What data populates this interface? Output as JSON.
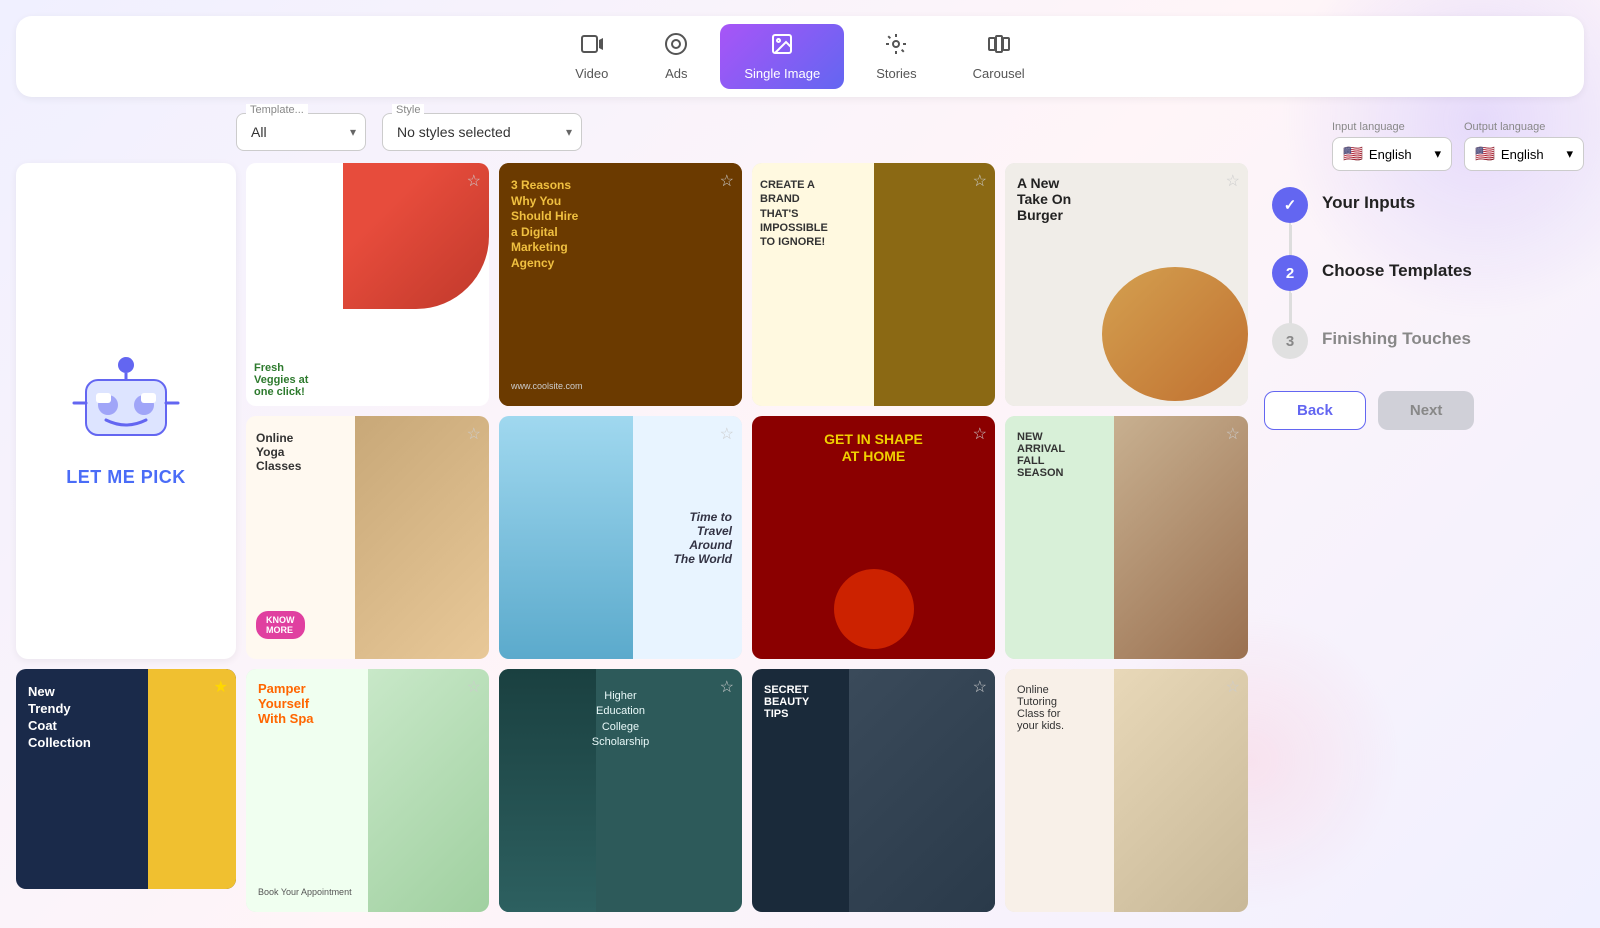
{
  "header": {
    "nav_items": [
      {
        "id": "video",
        "label": "Video",
        "icon": "▶",
        "active": false
      },
      {
        "id": "ads",
        "label": "Ads",
        "icon": "◎",
        "active": false
      },
      {
        "id": "single-image",
        "label": "Single Image",
        "icon": "🖼",
        "active": true
      },
      {
        "id": "stories",
        "label": "Stories",
        "icon": "⊕",
        "active": false
      },
      {
        "id": "carousel",
        "label": "Carousel",
        "icon": "◫",
        "active": false
      }
    ]
  },
  "filters": {
    "template_label": "Template...",
    "template_value": "All",
    "style_label": "Style",
    "style_value": "No styles selected"
  },
  "grid": {
    "let_me_pick_label": "LET ME PICK",
    "cards": [
      {
        "id": "tomatoes",
        "title": "Fresh Veggies at one click!",
        "class": "tomatoes-card"
      },
      {
        "id": "marketing",
        "title": "3 Reasons Why You Should Hire a Digital Marketing Agency",
        "class": "card-marketing"
      },
      {
        "id": "brand",
        "title": "CREATE A BRAND THAT'S IMPOSSIBLE TO IGNORE!",
        "class": "card-brand"
      },
      {
        "id": "burger",
        "title": "A New Take On Burger",
        "class": "burger-card"
      },
      {
        "id": "yoga",
        "title": "Online Yoga Classes",
        "class": "yoga-card"
      },
      {
        "id": "travel",
        "title": "Time to Travel Around The World",
        "class": "card-travel"
      },
      {
        "id": "fitness",
        "title": "GET IN SHAPE AT HOME",
        "class": "card-fitness"
      },
      {
        "id": "fall",
        "title": "NEW ARRIVAL FALL SEASON",
        "class": "card-fall"
      },
      {
        "id": "coat",
        "title": "New Trendy Coat Collection",
        "class": "coat-card"
      },
      {
        "id": "spa",
        "title": "Pamper Yourself With Spa",
        "class": "spa-card"
      },
      {
        "id": "scholarship",
        "title": "Higher Education College Scholarship",
        "class": "card-scholarship"
      },
      {
        "id": "beauty",
        "title": "SECRET BEAUTY TIPS",
        "class": "card-beauty"
      },
      {
        "id": "tutoring",
        "title": "Online Tutoring Class for your kids.",
        "class": "card-tutoring"
      }
    ]
  },
  "sidebar": {
    "input_language_label": "Input language",
    "output_language_label": "Output language",
    "input_language": "English",
    "output_language": "English",
    "steps": [
      {
        "number": "✓",
        "label": "Your Inputs",
        "state": "done"
      },
      {
        "number": "2",
        "label": "Choose Templates",
        "state": "active"
      },
      {
        "number": "3",
        "label": "Finishing Touches",
        "state": "inactive"
      }
    ],
    "back_label": "Back",
    "next_label": "Next"
  }
}
